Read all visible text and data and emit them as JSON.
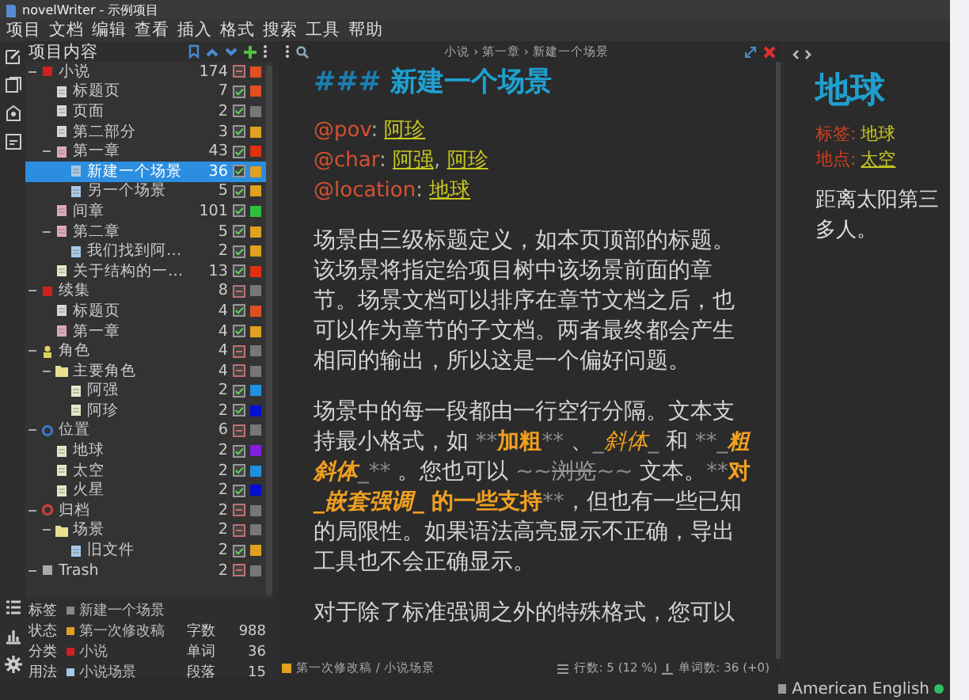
{
  "window": {
    "title": "novelWriter - 示例项目"
  },
  "menu": [
    "项目",
    "文档",
    "编辑",
    "查看",
    "插入",
    "格式",
    "搜索",
    "工具",
    "帮助"
  ],
  "tree": {
    "title": "项目内容",
    "items": [
      {
        "name": "小说",
        "kind": "novel",
        "count": "174",
        "active": false,
        "color": "#e05020",
        "expanded": true,
        "selected": false,
        "children": [
          {
            "name": "标题页",
            "kind": "title",
            "count": "7",
            "active": true,
            "color": "#e05020",
            "selected": false
          },
          {
            "name": "页面",
            "kind": "title",
            "count": "2",
            "active": true,
            "color": "#777777",
            "selected": false
          },
          {
            "name": "第二部分",
            "kind": "title",
            "count": "3",
            "active": true,
            "color": "#e0a020",
            "selected": false
          },
          {
            "name": "第一章",
            "kind": "chapter",
            "count": "43",
            "active": true,
            "color": "#e03010",
            "expanded": true,
            "selected": false,
            "children": [
              {
                "name": "新建一个场景",
                "kind": "scene",
                "count": "36",
                "active": true,
                "color": "#e0a020",
                "selected": true
              },
              {
                "name": "另一个场景",
                "kind": "scene",
                "count": "5",
                "active": true,
                "color": "#e0a020",
                "selected": false
              }
            ]
          },
          {
            "name": "间章",
            "kind": "chapter",
            "count": "101",
            "active": true,
            "color": "#30c040",
            "selected": false
          },
          {
            "name": "第二章",
            "kind": "chapter",
            "count": "5",
            "active": true,
            "color": "#e0a020",
            "expanded": true,
            "selected": false,
            "children": [
              {
                "name": "我们找到阿…",
                "kind": "scene",
                "count": "2",
                "active": true,
                "color": "#e0a020",
                "selected": false
              }
            ]
          },
          {
            "name": "关于结构的一…",
            "kind": "note",
            "count": "13",
            "active": true,
            "color": "#e03010",
            "selected": false
          }
        ]
      },
      {
        "name": "续集",
        "kind": "novel",
        "count": "8",
        "active": false,
        "color": "#777777",
        "expanded": true,
        "selected": false,
        "children": [
          {
            "name": "标题页",
            "kind": "title",
            "count": "4",
            "active": true,
            "color": "#e05020",
            "selected": false
          },
          {
            "name": "第一章",
            "kind": "chapter",
            "count": "4",
            "active": true,
            "color": "#e0a020",
            "selected": false
          }
        ]
      },
      {
        "name": "角色",
        "kind": "characters",
        "count": "4",
        "active": false,
        "color": "#777777",
        "expanded": true,
        "selected": false,
        "children": [
          {
            "name": "主要角色",
            "kind": "folder",
            "count": "4",
            "active": false,
            "color": "#777777",
            "expanded": true,
            "selected": false,
            "children": [
              {
                "name": "阿强",
                "kind": "note",
                "count": "2",
                "active": true,
                "color": "#2090e0",
                "selected": false
              },
              {
                "name": "阿珍",
                "kind": "note",
                "count": "2",
                "active": true,
                "color": "#0010d0",
                "selected": false
              }
            ]
          }
        ]
      },
      {
        "name": "位置",
        "kind": "locations",
        "count": "6",
        "active": false,
        "color": "#777777",
        "expanded": true,
        "selected": false,
        "children": [
          {
            "name": "地球",
            "kind": "note",
            "count": "2",
            "active": true,
            "color": "#8020e0",
            "selected": false
          },
          {
            "name": "太空",
            "kind": "note",
            "count": "2",
            "active": true,
            "color": "#2090e0",
            "selected": false
          },
          {
            "name": "火星",
            "kind": "note",
            "count": "2",
            "active": true,
            "color": "#0010d0",
            "selected": false
          }
        ]
      },
      {
        "name": "归档",
        "kind": "archive",
        "count": "2",
        "active": false,
        "color": "#777777",
        "expanded": true,
        "selected": false,
        "children": [
          {
            "name": "场景",
            "kind": "folder",
            "count": "2",
            "active": false,
            "color": "#777777",
            "expanded": true,
            "selected": false,
            "children": [
              {
                "name": "旧文件",
                "kind": "scene",
                "count": "2",
                "active": true,
                "color": "#e0a020",
                "selected": false
              }
            ]
          }
        ]
      },
      {
        "name": "Trash",
        "kind": "trash",
        "count": "2",
        "active": false,
        "color": "#777777",
        "expanded": true,
        "selected": false
      }
    ]
  },
  "details": [
    {
      "label": "标签",
      "value": "新建一个场景",
      "color": "#888888"
    },
    {
      "label": "状态",
      "value": "第一次修改稿",
      "color": "#e0a020",
      "stat_label": "字数",
      "stat_value": "988"
    },
    {
      "label": "分类",
      "value": "小说",
      "color": "#d02020",
      "stat_label": "单词",
      "stat_value": "36"
    },
    {
      "label": "用法",
      "value": "小说场景",
      "color": "#a0c8e8",
      "stat_label": "段落",
      "stat_value": "15"
    }
  ],
  "editor": {
    "breadcrumb": "小说 › 第一章 › 新建一个场景",
    "heading": {
      "marker": "###",
      "text": "新建一个场景"
    },
    "meta": [
      {
        "key": "@pov",
        "colon": ":",
        "values": [
          "阿珍"
        ]
      },
      {
        "key": "@char",
        "colon": ":",
        "separator": ",",
        "values": [
          "阿强",
          "阿珍"
        ]
      },
      {
        "key": "@location",
        "colon": ":",
        "values": [
          "地球"
        ]
      }
    ],
    "paragraphs": [
      [
        {
          "kind": "plain",
          "text": "场景由三级标题定义，如本页顶部的标题。该场景将指定给项目树中该场景前面的章节。场景文档可以排序在章节文档之后，也可以作为章节的子文档。两者最终都会产生相同的输出，所以这是一个偏好问题。"
        }
      ],
      [
        {
          "kind": "plain",
          "text": "场景中的每一段都由一行空行分隔。文本支持最小格式，如 "
        },
        {
          "kind": "markup",
          "text": "**"
        },
        {
          "kind": "bold",
          "text": "加粗"
        },
        {
          "kind": "markup",
          "text": "**"
        },
        {
          "kind": "plain",
          "text": " 、"
        },
        {
          "kind": "markup",
          "text": "_"
        },
        {
          "kind": "italic",
          "text": "斜体"
        },
        {
          "kind": "markup",
          "text": "_"
        },
        {
          "kind": "plain",
          "text": " 和 "
        },
        {
          "kind": "markup",
          "text": "**_"
        },
        {
          "kind": "bolditalic",
          "text": "粗斜体"
        },
        {
          "kind": "markup",
          "text": "_**"
        },
        {
          "kind": "plain",
          "text": " 。您也可以 "
        },
        {
          "kind": "markup",
          "text": "~~"
        },
        {
          "kind": "strike",
          "text": "浏览"
        },
        {
          "kind": "markup",
          "text": "~~"
        },
        {
          "kind": "plain",
          "text": " 文本。"
        },
        {
          "kind": "markup",
          "text": "**"
        },
        {
          "kind": "bold",
          "text": "对 "
        },
        {
          "kind": "bolditalic",
          "text": "_嵌套强调_"
        },
        {
          "kind": "bold",
          "text": " 的一些支持"
        },
        {
          "kind": "markup",
          "text": "**"
        },
        {
          "kind": "plain",
          "text": "，但也有一些已知的局限性。如果语法高亮显示不正确，导出工具也不会正确显示。"
        }
      ],
      [
        {
          "kind": "plain",
          "text": "对于除了标准强调之外的特殊格式，您可以"
        }
      ]
    ],
    "footer": {
      "status": "第一次修改稿 / 小说场景",
      "color": "#e0a020",
      "lines": "行数: 5 (12 %)",
      "words": "单词数: 36 (+0)"
    }
  },
  "viewer": {
    "title": "地球",
    "meta": [
      {
        "key": "标签:",
        "value": "地球",
        "link": false
      },
      {
        "key": "地点:",
        "value": "太空",
        "link": true
      }
    ],
    "lines": [
      "距离太阳第三",
      "多人。"
    ]
  },
  "status_bar": {
    "language": "American English"
  }
}
